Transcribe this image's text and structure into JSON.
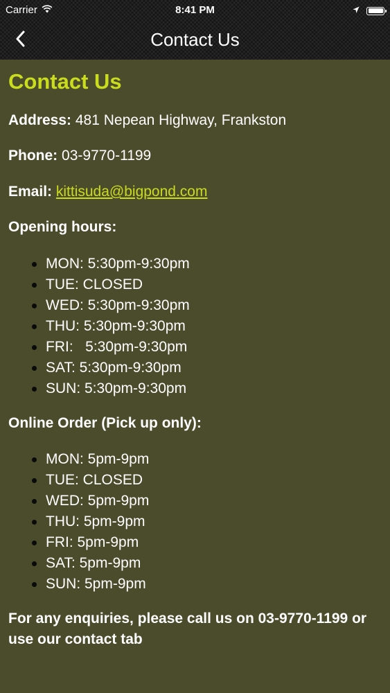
{
  "status_bar": {
    "carrier": "Carrier",
    "time": "8:41 PM",
    "icons": [
      "wifi-icon",
      "location-arrow-icon",
      "battery-icon"
    ]
  },
  "nav": {
    "title": "Contact Us",
    "back_icon": "chevron-left-icon"
  },
  "page": {
    "heading": "Contact Us",
    "address_label": "Address:",
    "address_value": "481 Nepean Highway, Frankston",
    "phone_label": "Phone:",
    "phone_value": "03-9770-1199",
    "email_label": "Email:",
    "email_value": "kittisuda@bigpond.com",
    "opening_hours_heading": "Opening hours:",
    "opening_hours": [
      "MON: 5:30pm-9:30pm",
      "TUE: CLOSED",
      "WED: 5:30pm-9:30pm",
      "THU: 5:30pm-9:30pm",
      "FRI:   5:30pm-9:30pm",
      "SAT: 5:30pm-9:30pm",
      "SUN: 5:30pm-9:30pm"
    ],
    "online_order_heading": "Online Order (Pick up only):",
    "online_order_hours": [
      "MON: 5pm-9pm",
      "TUE: CLOSED",
      "WED: 5pm-9pm",
      "THU: 5pm-9pm",
      "FRI: 5pm-9pm",
      "SAT: 5pm-9pm",
      "SUN: 5pm-9pm"
    ],
    "enquiry_text": "For any enquiries, please call us on 03-9770-1199 or use our contact tab"
  },
  "colors": {
    "background": "#4b4c2c",
    "accent": "#c9dc1e",
    "nav_background": "#141414",
    "text": "#ffffff"
  }
}
